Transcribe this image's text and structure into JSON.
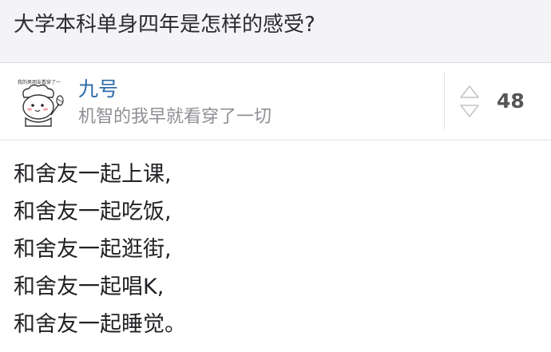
{
  "question": {
    "title": "大学本科单身四年是怎样的感受?"
  },
  "author": {
    "name": "九号",
    "bio": "机智的我早就看穿了一切",
    "avatar_icon": "cartoon-avatar-icon",
    "avatar_caption": "我的男朋友看穿了一"
  },
  "vote": {
    "count": "48",
    "icon": "vote-arrows-icon"
  },
  "answer": {
    "lines": [
      "和舍友一起上课,",
      "和舍友一起吃饭,",
      "和舍友一起逛街,",
      "和舍友一起唱K,",
      "和舍友一起睡觉。"
    ]
  },
  "colors": {
    "header_bg": "#f4f4f6",
    "author_name": "#2e6aa8",
    "bio": "#8f8f95",
    "text": "#222226"
  }
}
